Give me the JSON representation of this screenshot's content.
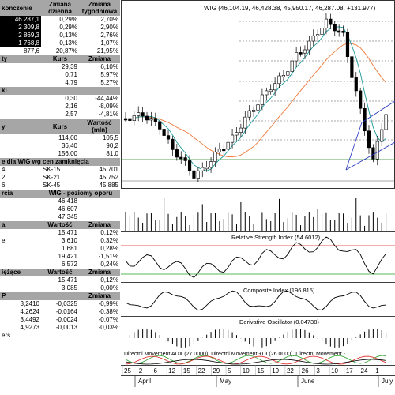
{
  "left_panel": {
    "indices": {
      "headers": [
        "kończenie",
        "Zmiana dzienna",
        "Zmiana tygodniowa"
      ],
      "rows": [
        [
          "46 287,1",
          "0,29%",
          "2,70%"
        ],
        [
          "2 309,8",
          "0,29%",
          "2,90%"
        ],
        [
          "2 869,3",
          "0,13%",
          "2,76%"
        ],
        [
          "1 768,8",
          "0,13%",
          "1,07%"
        ],
        [
          "877,6",
          "20,87%",
          "21,95%"
        ]
      ]
    },
    "gainers": {
      "headers": [
        "ty",
        "Kurs",
        "Zmiana"
      ],
      "rows": [
        [
          "",
          "29,39",
          "6,10%"
        ],
        [
          "",
          "0,71",
          "5,97%"
        ],
        [
          "",
          "4,79",
          "5,27%"
        ]
      ]
    },
    "losers": {
      "headers": [
        "ki",
        "",
        ""
      ],
      "rows": [
        [
          "",
          "0,30",
          "-44,44%"
        ],
        [
          "",
          "2,16",
          "-8,09%"
        ],
        [
          "",
          "2,57",
          "-4,81%"
        ]
      ]
    },
    "turnover": {
      "headers": [
        "y",
        "Kurs",
        "Wartość (mln)"
      ],
      "rows": [
        [
          "",
          "114,00",
          "105,5"
        ],
        [
          "",
          "36,40",
          "90,2"
        ],
        [
          "",
          "156,00",
          "81,0"
        ]
      ]
    },
    "futures": {
      "header": "e dla WIG wg cen zamknięcia",
      "rows": [
        [
          "4",
          "SK-15",
          "45 701"
        ],
        [
          "2",
          "SK-21",
          "45 752"
        ],
        [
          "6",
          "SK-45",
          "45 885"
        ]
      ]
    },
    "support": {
      "headers": [
        "rcia",
        "WIG - poziomy oporu"
      ],
      "rows": [
        "46 418",
        "46 607",
        "47 345"
      ]
    },
    "sectors": {
      "headers": [
        "a",
        "Wartość",
        "Zmiana"
      ],
      "rows": [
        [
          "",
          "15 471",
          "0,12%"
        ],
        [
          "e",
          "3 610",
          "0,32%"
        ],
        [
          "",
          "1 681",
          "0,28%"
        ],
        [
          "",
          "19 421",
          "-1,51%"
        ],
        [
          "",
          "6 572",
          "0,24%"
        ]
      ]
    },
    "other": {
      "headers": [
        "iężące",
        "Wartość",
        "Zmiana"
      ],
      "rows": [
        [
          "",
          "15 471",
          "0,12%"
        ],
        [
          "",
          "3 085",
          "0,00%"
        ]
      ]
    },
    "currency": {
      "headers": [
        "P",
        "",
        "Zmiana"
      ],
      "rows": [
        [
          "3,2410",
          "-0,0325",
          "-0,99%"
        ],
        [
          "4,2624",
          "-0,0164",
          "-0,38%"
        ],
        [
          "3,4492",
          "-0,0024",
          "-0,07%"
        ],
        [
          "4,9273",
          "-0,0013",
          "-0,03%"
        ]
      ],
      "footer": "ers"
    }
  },
  "chart": {
    "main_title": "WIG (46,104.19, 46,428.38, 45,950.17, 46,287.08, +131.977)",
    "rsi_title": "Relative Strength Index (54.6012)",
    "composite_title": "Composite Index (196.815)",
    "osc_title": "Derivative Oscillator (0.04738)",
    "adx_title": "Directnl Movement ADX (27.0000), Directnl Movement +DI (26.0000), Directnl Movement -",
    "days": [
      "25",
      "2",
      "6",
      "12",
      "15",
      "22",
      "29",
      "5",
      "10",
      "15",
      "19",
      "22",
      "26",
      "3",
      "10",
      "17",
      "24",
      "1"
    ],
    "months": [
      "April",
      "May",
      "June",
      "July"
    ],
    "colors": {
      "candle": "#000000",
      "ma_short": "#1a9a9a",
      "ma_long": "#f07838",
      "channel": "#2030c0",
      "rsi_hi": "#e02020",
      "rsi_lo": "#20a020",
      "adx": "#000000",
      "di_plus": "#20a020",
      "di_minus": "#e02020"
    }
  }
}
